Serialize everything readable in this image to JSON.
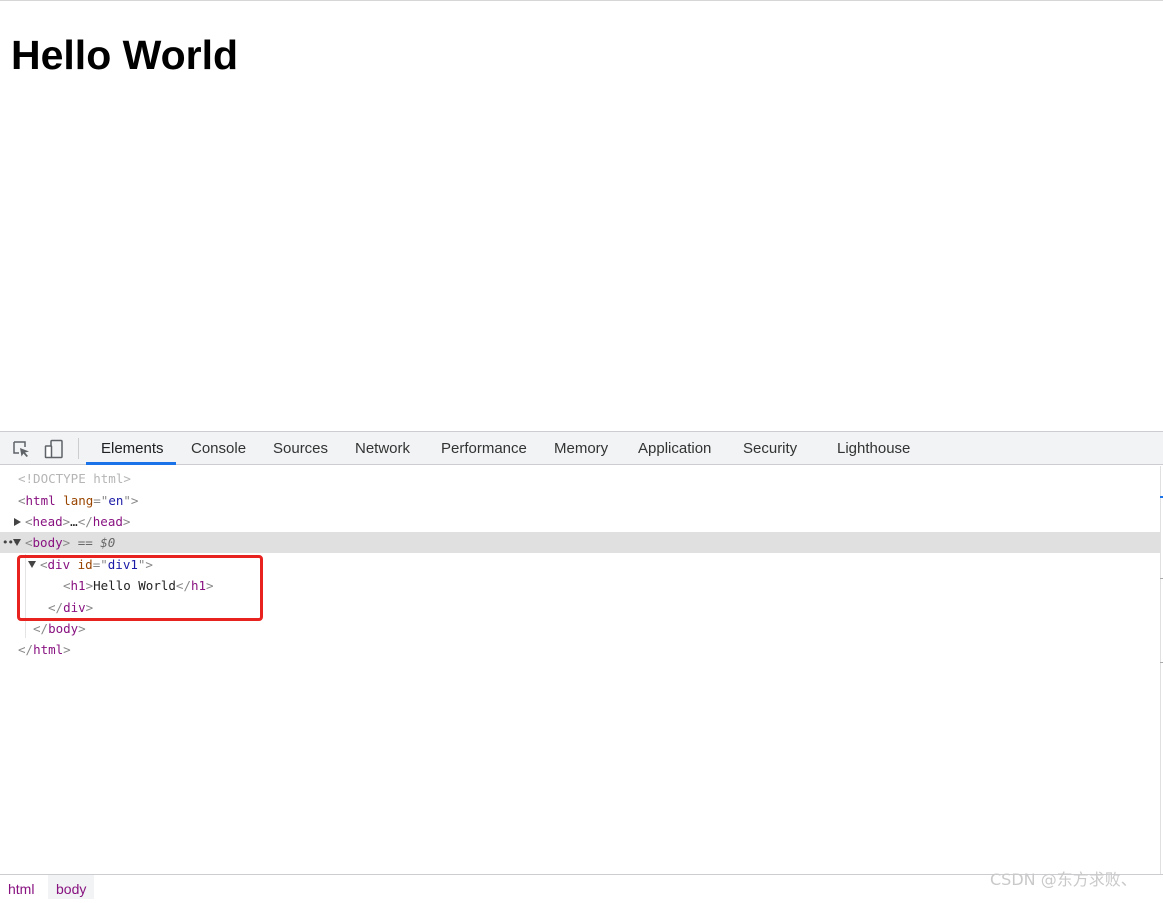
{
  "page": {
    "heading": "Hello World"
  },
  "devtools": {
    "tools": {
      "inspect_icon": "element-picker-icon",
      "device_icon": "device-toolbar-icon"
    },
    "tabs": [
      {
        "label": "Elements",
        "active": true
      },
      {
        "label": "Console"
      },
      {
        "label": "Sources"
      },
      {
        "label": "Network"
      },
      {
        "label": "Performance"
      },
      {
        "label": "Memory"
      },
      {
        "label": "Application"
      },
      {
        "label": "Security"
      },
      {
        "label": "Lighthouse"
      }
    ],
    "dom_tree": {
      "doctype": "<!DOCTYPE html>",
      "html_tag": "html",
      "html_attr_name": "lang",
      "html_attr_value": "en",
      "head_tag": "head",
      "head_ellipsis": "…",
      "body_tag": "body",
      "body_marker": "== $0",
      "row_dots": "•••",
      "div_tag": "div",
      "div_attr_name": "id",
      "div_attr_value": "div1",
      "h1_tag": "h1",
      "h1_text": "Hello World"
    },
    "breadcrumbs": [
      "html",
      "body"
    ]
  },
  "watermark": "CSDN @东方求败、",
  "colors": {
    "tag": "#881280",
    "attr_name": "#994500",
    "attr_value": "#1a1aa6",
    "active_tab": "#1a73e8",
    "highlight": "#e8231f"
  }
}
